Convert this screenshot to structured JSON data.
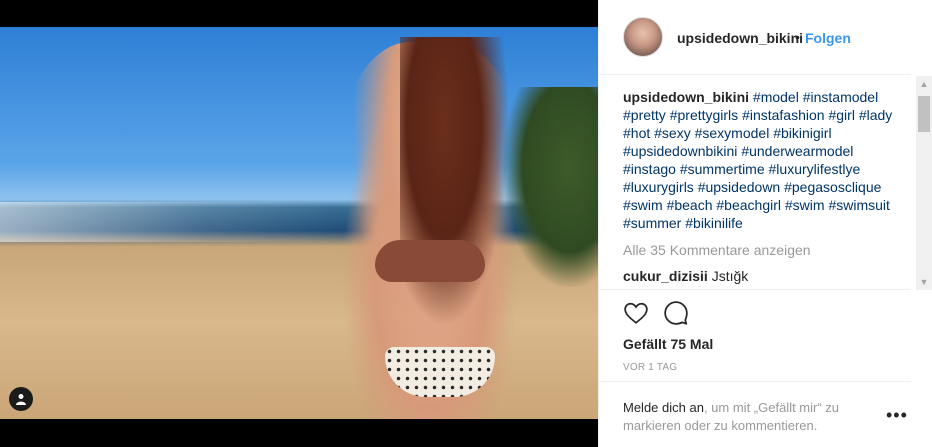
{
  "post": {
    "username": "upsidedown_bikini",
    "separator": "•",
    "follow_label": "Folgen"
  },
  "caption": {
    "username": "upsidedown_bikini",
    "hashtags": [
      "#model",
      "#instamodel",
      "#pretty",
      "#prettygirls",
      "#instafashion",
      "#girl",
      "#lady",
      "#hot",
      "#sexy",
      "#sexymodel",
      "#bikinigirl",
      "#upsidedownbikini",
      "#underwearmodel",
      "#instago",
      "#summertime",
      "#luxurylifestlye",
      "#luxurygirls",
      "#upsidedown",
      "#pegasosclique",
      "#swim",
      "#beach",
      "#beachgirl",
      "#swim",
      "#swimsuit",
      "#summer",
      "#bikinilife"
    ]
  },
  "comments": {
    "load_more": "Alle 35 Kommentare anzeigen",
    "items": [
      {
        "user": "cukur_dizisii",
        "text": "Jstığk"
      }
    ]
  },
  "stats": {
    "likes": "Gefällt 75 Mal",
    "time": "VOR 1 TAG"
  },
  "login": {
    "link": "Melde dich an",
    "rest": ", um mit „Gefällt mir“ zu markieren oder zu kommentieren."
  },
  "icons": {
    "heart": "heart-icon",
    "comment": "comment-icon",
    "user_tag": "user-tag-icon",
    "more": "more-options-icon"
  },
  "colors": {
    "link_blue": "#3897f0",
    "hashtag": "#003569",
    "text": "#262626",
    "muted": "#999999"
  }
}
